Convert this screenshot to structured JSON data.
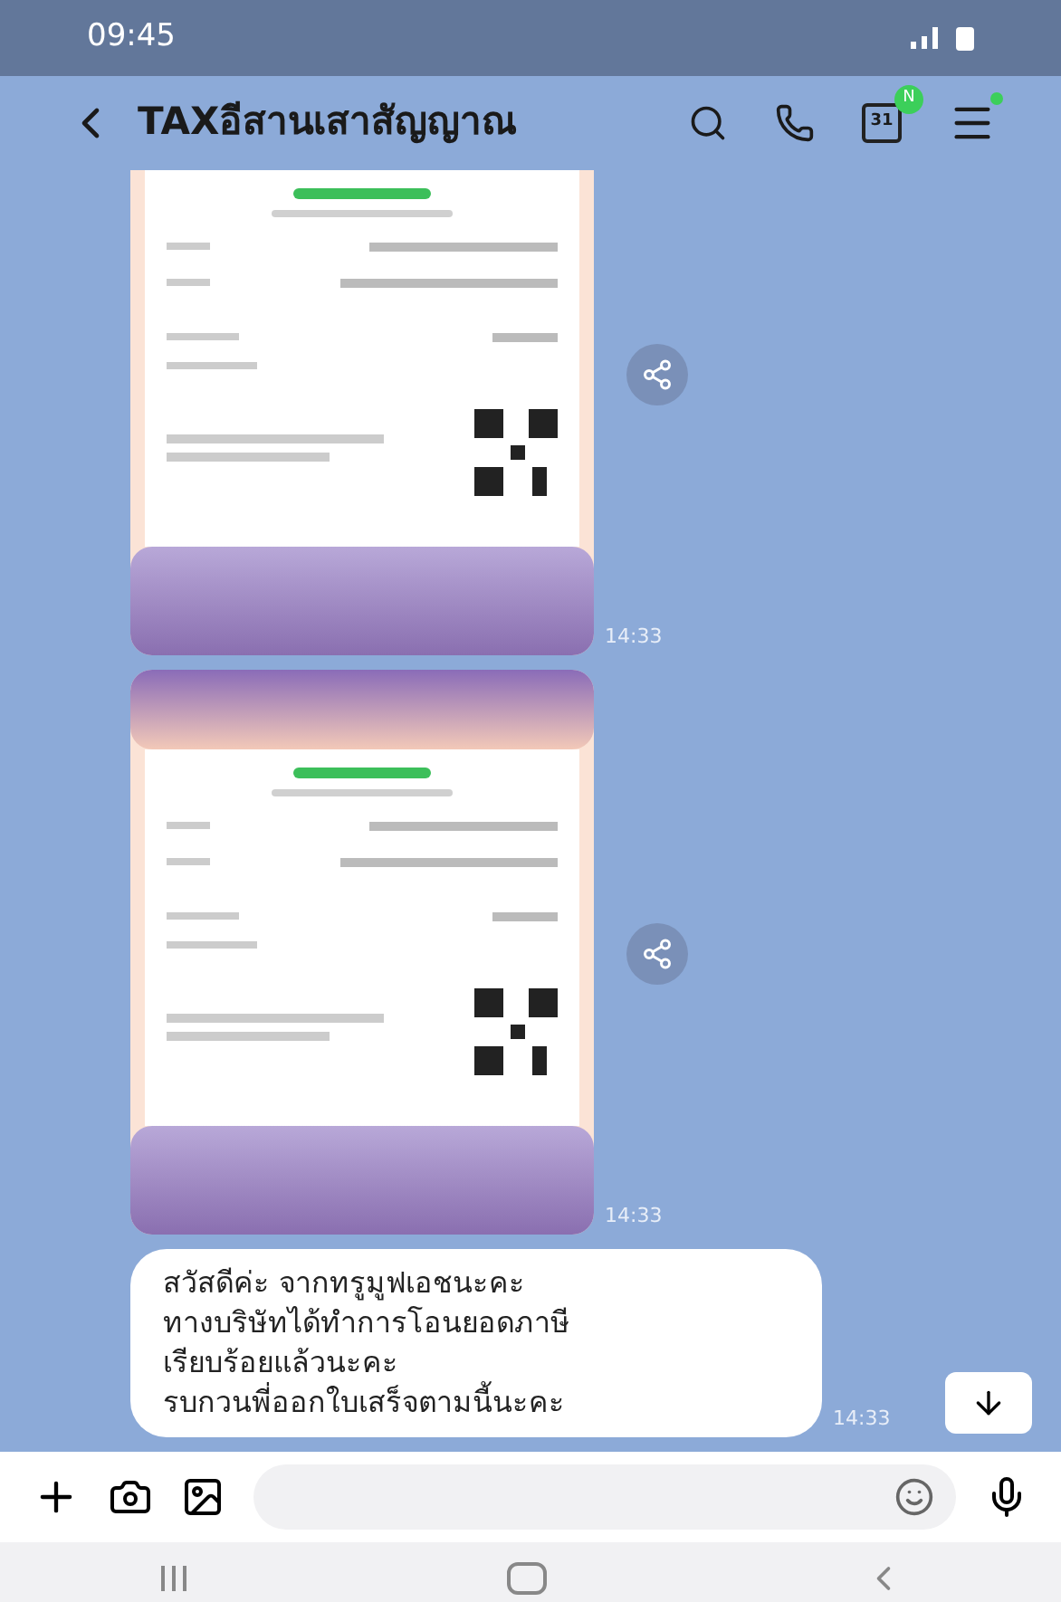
{
  "status_bar": {
    "time": "09:45"
  },
  "header": {
    "title": "TAXอีสานเสาสัญญาณ",
    "calendar_day": "31",
    "calendar_badge": "N",
    "menu_notification": true
  },
  "messages": [
    {
      "kind": "image",
      "cut_top": true,
      "time": "14:33",
      "share": true
    },
    {
      "kind": "image",
      "cut_top": false,
      "time": "14:33",
      "share": true
    },
    {
      "kind": "text",
      "lines": [
        "สวัสดีค่ะ จากทรูมูฟเอชนะคะ",
        "ทางบริษัทได้ทำการโอนยอดภาษี",
        "เรียบร้อยแล้วนะคะ",
        "รบกวนพี่ออกใบเสร็จตามนี้นะคะ"
      ],
      "time": "14:33"
    }
  ]
}
